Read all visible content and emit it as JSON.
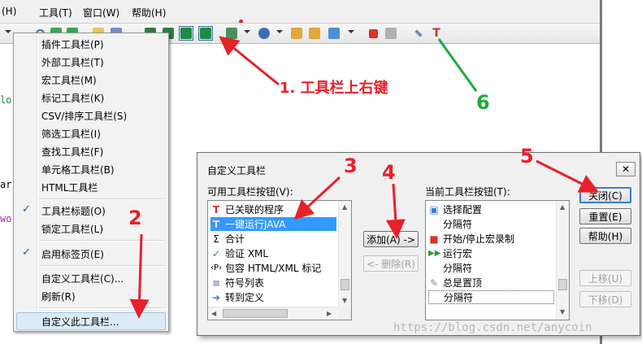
{
  "menubar": {
    "items": [
      "(H)",
      "工具(T)",
      "窗口(W)",
      "帮助(H)"
    ]
  },
  "toolbar": {
    "icons": [
      "arrow-icon",
      "magnifier-icon",
      "refresh-icon",
      "open-icon",
      "run-icon",
      "pressed-run-icon",
      "pressed-run-java-icon",
      "grid-icon",
      "globe-icon",
      "macro-icon",
      "config-icon",
      "stop-record-icon",
      "play-macro-icon",
      "pin-icon",
      "hammer-icon"
    ]
  },
  "editor": {
    "fragments": [
      "lo",
      "ar",
      "wo"
    ]
  },
  "context_menu": {
    "items": [
      {
        "label": "插件工具栏(P)",
        "checked": false
      },
      {
        "label": "外部工具栏(T)",
        "checked": false
      },
      {
        "label": "宏工具栏(M)",
        "checked": false
      },
      {
        "label": "标记工具栏(K)",
        "checked": false
      },
      {
        "label": "CSV/排序工具栏(S)",
        "checked": false
      },
      {
        "label": "筛选工具栏(I)",
        "checked": false
      },
      {
        "label": "查找工具栏(F)",
        "checked": false
      },
      {
        "label": "单元格工具栏(B)",
        "checked": false
      },
      {
        "label": "HTML工具栏",
        "checked": false
      },
      {
        "label": "工具栏标题(O)",
        "checked": true
      },
      {
        "label": "锁定工具栏(L)",
        "checked": false
      },
      {
        "label": "启用标签页(E)",
        "checked": true
      },
      {
        "label": "自定义工具栏(C)...",
        "checked": false
      },
      {
        "label": "刷新(R)",
        "checked": false
      },
      {
        "label": "自定义此工具栏...",
        "checked": false
      }
    ],
    "check_mark": "✓"
  },
  "dialog": {
    "title": "自定义工具栏",
    "close_glyph": "✕",
    "available_label": "可用工具栏按钮(V):",
    "current_label": "当前工具栏按钮(T):",
    "available_items": [
      {
        "label": "已关联的程序",
        "icon": "hammer-icon",
        "selected": false
      },
      {
        "label": "一键运行JAVA",
        "icon": "hammer-icon",
        "selected": true
      },
      {
        "label": "合计",
        "icon": "sigma-icon",
        "selected": false
      },
      {
        "label": "验证 XML",
        "icon": "check-doc-icon",
        "selected": false
      },
      {
        "label": "包容 HTML/XML 标记",
        "icon": "tag-icon",
        "selected": false
      },
      {
        "label": "符号列表",
        "icon": "list-icon",
        "selected": false
      },
      {
        "label": "转到定义",
        "icon": "goto-icon",
        "selected": false
      }
    ],
    "current_items": [
      {
        "label": "选择配置",
        "icon": "config-icon",
        "selected": false
      },
      {
        "label": "分隔符",
        "icon": "",
        "selected": false
      },
      {
        "label": "开始/停止宏录制",
        "icon": "stop-record-icon",
        "selected": false
      },
      {
        "label": "运行宏",
        "icon": "play-macro-icon",
        "selected": false
      },
      {
        "label": "分隔符",
        "icon": "",
        "selected": false
      },
      {
        "label": "总是置顶",
        "icon": "pin-icon",
        "selected": false
      },
      {
        "label": "分隔符",
        "icon": "",
        "selected": false
      }
    ],
    "buttons": {
      "add": "添加(A) ->",
      "remove": "<- 删除(R)",
      "close": "关闭(C)",
      "reset": "重置(E)",
      "help": "帮助(H)",
      "up": "上移(U)",
      "down": "下移(D)"
    }
  },
  "annotations": {
    "step1": "1. 工具栏上右键",
    "step2": "2",
    "step3": "3",
    "step4": "4",
    "step5": "5",
    "step6": "6"
  },
  "watermark": "https://blog.csdn.net/anycoin",
  "colors": {
    "annotation_red": "#e8202a",
    "annotation_green": "#1faa3e",
    "selection_blue": "#3399ff",
    "default_button_border": "#3a7bd5"
  }
}
